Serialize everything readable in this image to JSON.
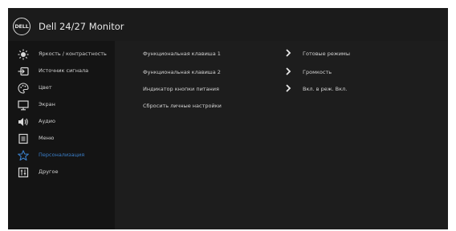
{
  "header": {
    "logo_text": "DELL",
    "title": "Dell 24/27 Monitor"
  },
  "menu": [
    {
      "label": "Яркость / контрастность",
      "icon": "brightness-icon"
    },
    {
      "label": "Источник сигнала",
      "icon": "input-source-icon"
    },
    {
      "label": "Цвет",
      "icon": "color-palette-icon"
    },
    {
      "label": "Экран",
      "icon": "display-icon"
    },
    {
      "label": "Аудио",
      "icon": "audio-icon"
    },
    {
      "label": "Меню",
      "icon": "menu-icon"
    },
    {
      "label": "Персонализация",
      "icon": "star-icon",
      "active": true
    },
    {
      "label": "Другое",
      "icon": "other-icon"
    }
  ],
  "options": [
    {
      "label": "Функциональная клавиша 1",
      "value": "Готовые режимы"
    },
    {
      "label": "Функциональная клавиша 2",
      "value": "Громкость"
    },
    {
      "label": "Индикатор кнопки питания",
      "value": "Вкл. в реж. Вкл."
    },
    {
      "label": "Сбросить личные настройки"
    }
  ],
  "colors": {
    "accent": "#3a7ec8",
    "panel": "#1d1d1d",
    "sidebar": "#141414",
    "text": "#d2d2d2"
  }
}
